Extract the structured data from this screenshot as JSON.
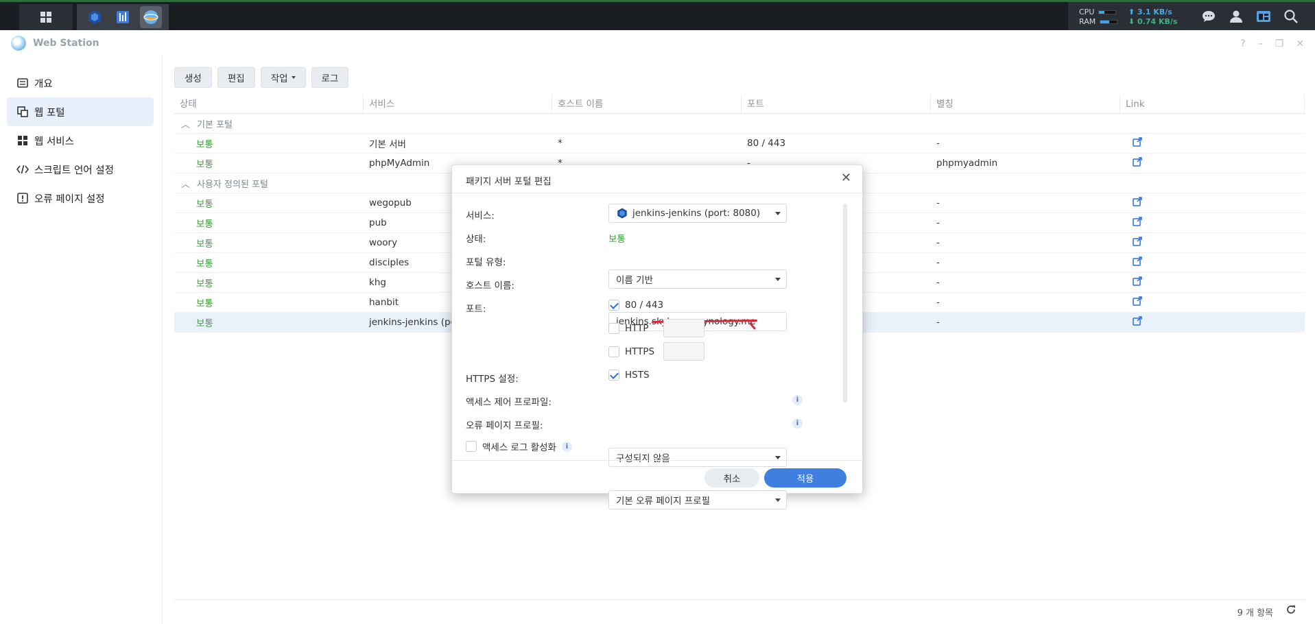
{
  "taskbar": {
    "cpu_label": "CPU",
    "ram_label": "RAM",
    "cpu_fill": 0.3,
    "ram_fill": 0.55,
    "upload": "⬆ 3.1 KB/s",
    "download": "⬇ 0.74 KB/s"
  },
  "window": {
    "title": "Web Station",
    "controls": [
      "?",
      "–",
      "❐",
      "✕"
    ]
  },
  "sidebar": {
    "items": [
      {
        "label": "개요",
        "icon": "list-icon"
      },
      {
        "label": "웹 포털",
        "icon": "portal-icon",
        "active": true
      },
      {
        "label": "웹 서비스",
        "icon": "grid-icon"
      },
      {
        "label": "스크립트 언어 설정",
        "icon": "code-icon"
      },
      {
        "label": "오류 페이지 설정",
        "icon": "alert-icon"
      }
    ]
  },
  "toolbar": {
    "create": "생성",
    "edit": "편집",
    "action": "작업",
    "log": "로그"
  },
  "grid": {
    "columns": [
      "상태",
      "서비스",
      "호스트 이름",
      "포트",
      "별칭",
      "Link"
    ],
    "group_default": "기본 포털",
    "group_custom": "사용자 정의된 포털",
    "rows_default": [
      {
        "status": "보통",
        "service": "기본 서버",
        "host": "*",
        "port": "80 / 443",
        "alias": "-"
      },
      {
        "status": "보통",
        "service": "phpMyAdmin",
        "host": "*",
        "port": "-",
        "alias": "phpmyadmin"
      }
    ],
    "rows_custom": [
      {
        "status": "보통",
        "service": "wegopub",
        "alias": "-"
      },
      {
        "status": "보통",
        "service": "pub",
        "alias": "-"
      },
      {
        "status": "보통",
        "service": "woory",
        "alias": "-"
      },
      {
        "status": "보통",
        "service": "disciples",
        "alias": "-"
      },
      {
        "status": "보통",
        "service": "khg",
        "alias": "-"
      },
      {
        "status": "보통",
        "service": "hanbit",
        "alias": "-"
      },
      {
        "status": "보통",
        "service": "jenkins-jenkins (po",
        "alias": "-"
      }
    ],
    "footer_count": "9 개 항목"
  },
  "modal": {
    "title": "패키지 서버 포털 편집",
    "service_label": "서비스:",
    "service_value": "jenkins-jenkins (port: 8080)",
    "status_label": "상태:",
    "status_value": "보통",
    "portal_type_label": "포털 유형:",
    "portal_type_value": "이름 기반",
    "hostname_label": "호스트 이름:",
    "hostname_value": "jenkins.skyhopes.synology.me",
    "port_label": "포트:",
    "port_80_443": "80 / 443",
    "http_label": "HTTP",
    "https_label": "HTTPS",
    "https_settings_label": "HTTPS 설정:",
    "hsts_label": "HSTS",
    "access_profile_label": "액세스 제어 프로파일:",
    "access_profile_value": "구성되지 않음",
    "error_profile_label": "오류 페이지 프로필:",
    "error_profile_value": "기본 오류 페이지 프로필",
    "access_log_label": "액세스 로그 활성화",
    "cancel": "취소",
    "apply": "적용"
  }
}
